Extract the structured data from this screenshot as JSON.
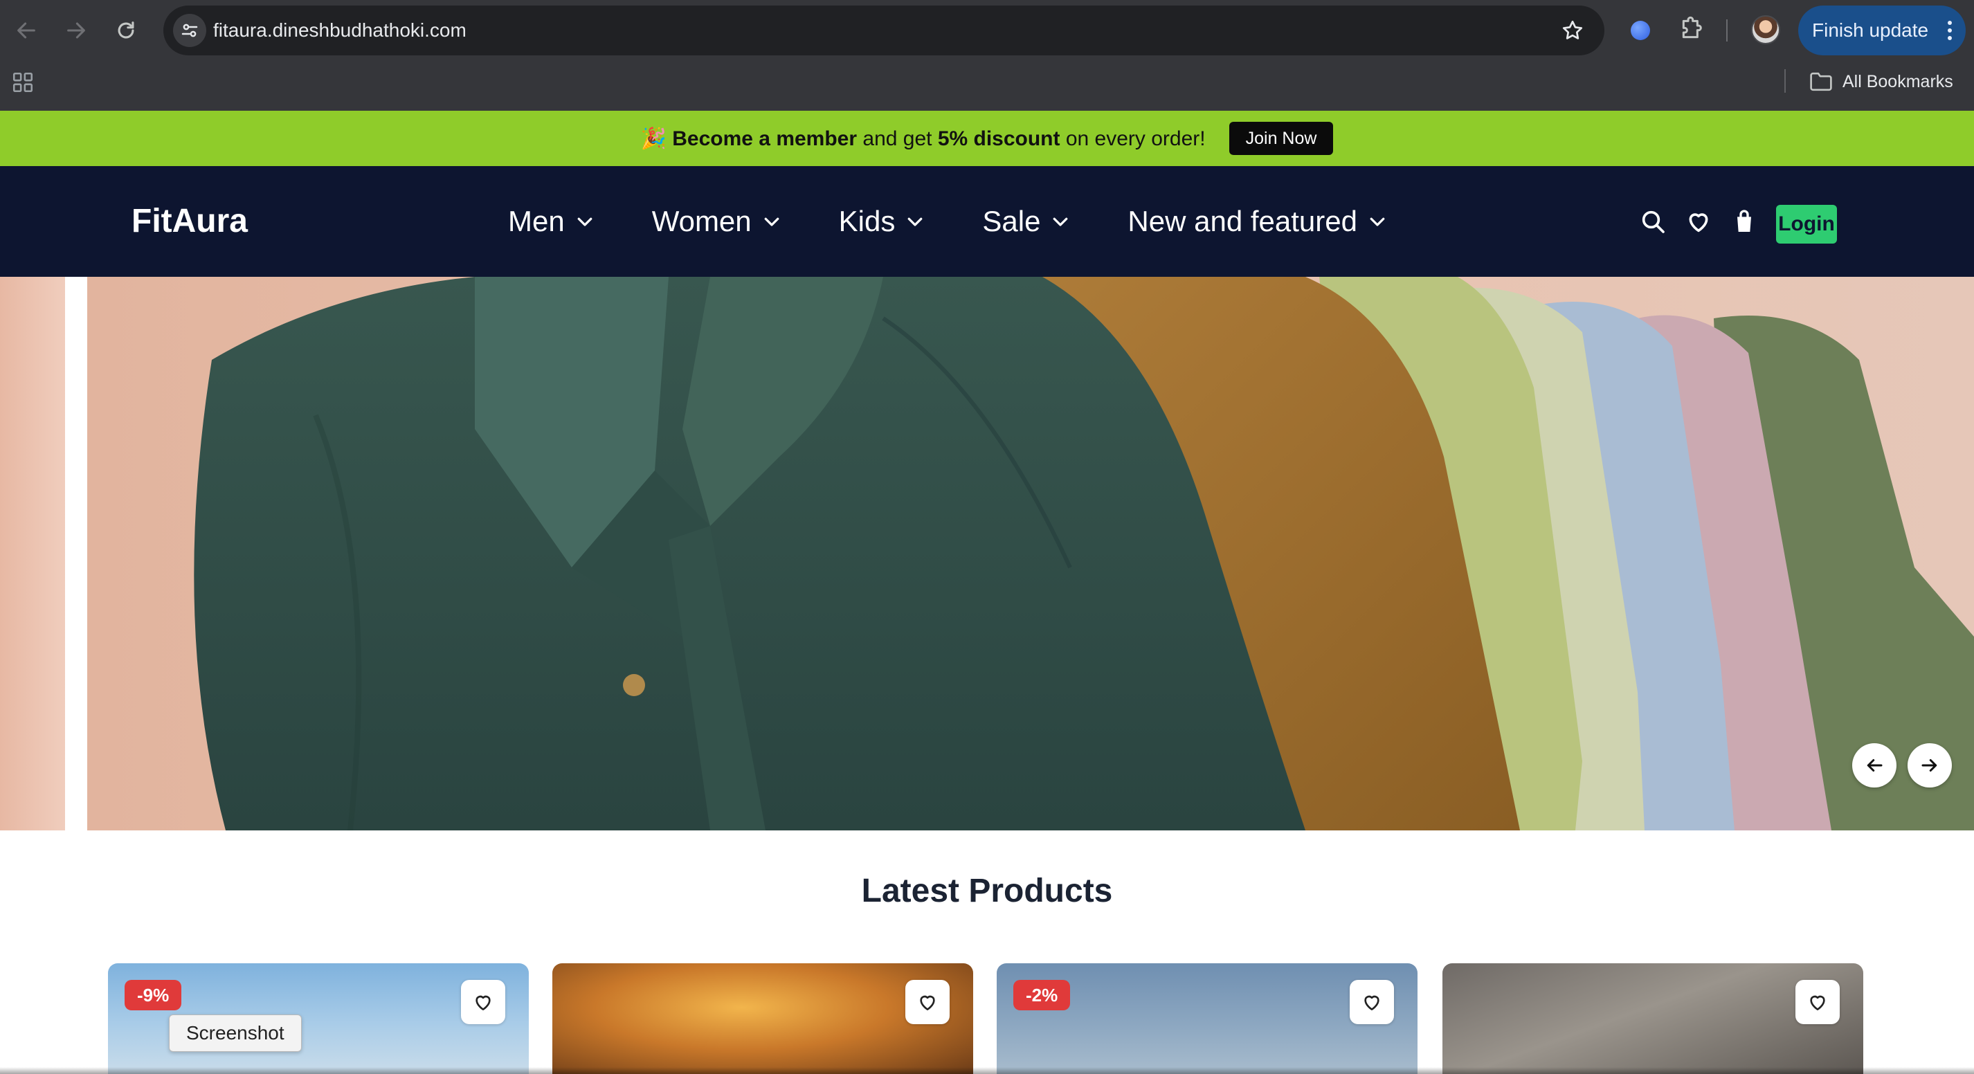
{
  "browser": {
    "url": "fitaura.dineshbudhathoki.com",
    "finish_update_label": "Finish update",
    "all_bookmarks_label": "All Bookmarks",
    "icons": [
      "back-icon",
      "forward-icon",
      "reload-icon",
      "site-info-icon",
      "bookmark-star-icon",
      "extension-icon",
      "puzzle-icon",
      "profile-avatar",
      "menu-kebab-icon",
      "apps-grid-icon",
      "folder-icon"
    ]
  },
  "promo": {
    "emoji": "🎉",
    "strong_1": "Become a member",
    "text_1": " and get ",
    "strong_2": "5% discount",
    "text_2": " on every order!",
    "join_label": "Join Now",
    "background": "#8fcc2a"
  },
  "header": {
    "logo": "FitAura",
    "nav": [
      {
        "label": "Men"
      },
      {
        "label": "Women"
      },
      {
        "label": "Kids"
      },
      {
        "label": "Sale"
      },
      {
        "label": "New and featured"
      }
    ],
    "login_label": "Login",
    "background": "#0d1530",
    "login_color": "#2ecc71"
  },
  "main": {
    "section_title": "Latest Products",
    "products": [
      {
        "badge": "-9%"
      },
      {
        "badge": ""
      },
      {
        "badge": "-2%"
      },
      {
        "badge": ""
      }
    ],
    "tooltip": "Screenshot"
  }
}
